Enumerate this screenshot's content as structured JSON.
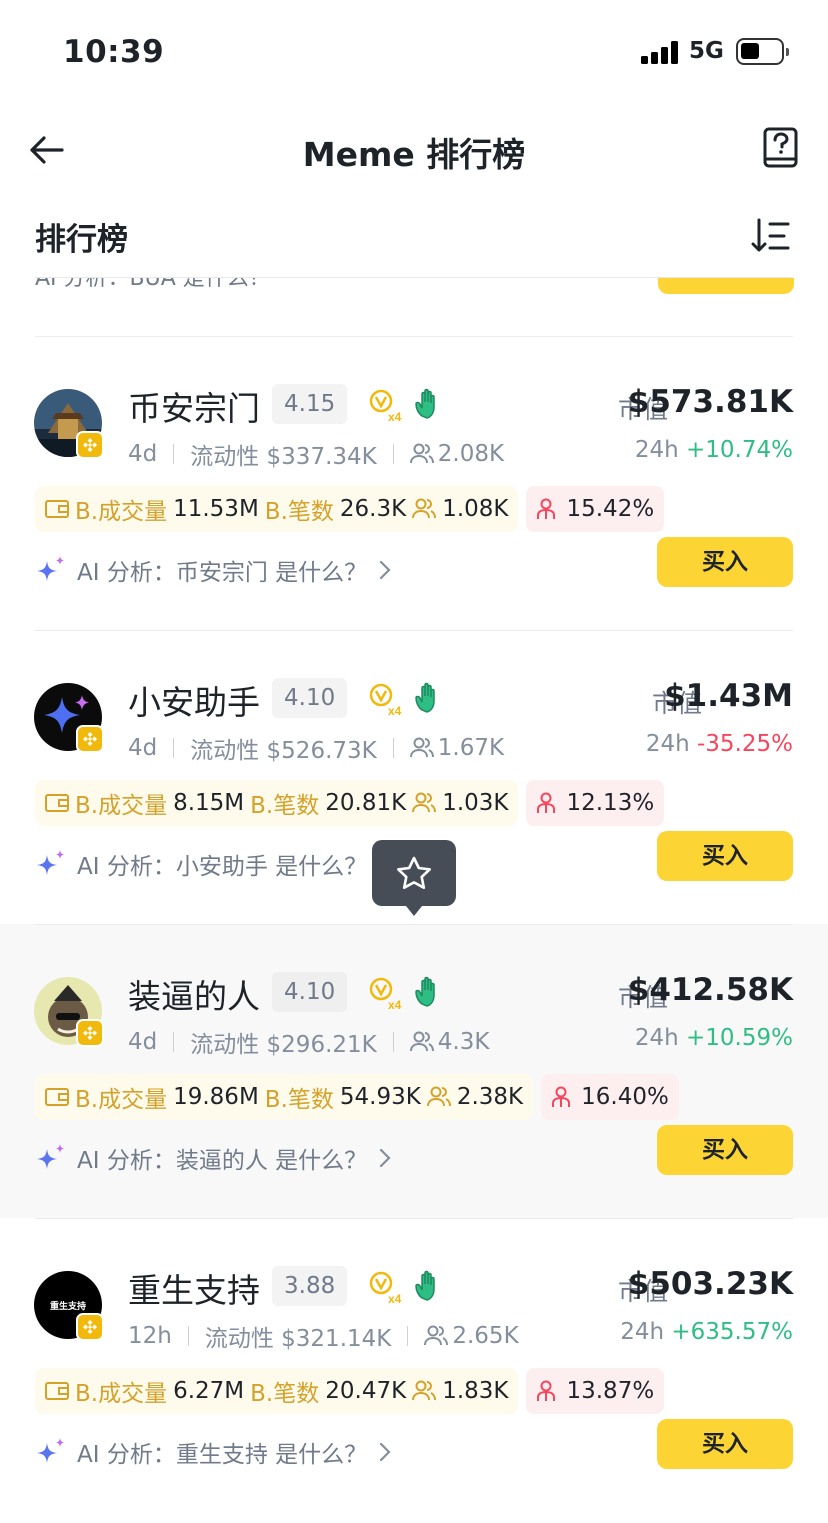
{
  "status_bar": {
    "time": "10:39",
    "network": "5G"
  },
  "nav": {
    "title": "Meme 排行榜"
  },
  "section": {
    "title": "排行榜"
  },
  "peek": {
    "ai_text": "AI 分析：BUA 是什么？"
  },
  "colors": {
    "accent": "#fcd535",
    "up": "#2ebd85",
    "down": "#f6465d",
    "tag_label": "#d4a22a"
  },
  "tokens": [
    {
      "name": "币安宗门",
      "score": "4.15",
      "age": "4d",
      "liquidity": "流动性 $337.34K",
      "holders": "2.08K",
      "mcap_label": "市值",
      "mcap": "$573.81K",
      "change_label": "24h",
      "change": "+10.74%",
      "direction": "up",
      "b_volume_label": "B.成交量",
      "b_volume": "11.53M",
      "b_trades_label": "B.笔数",
      "b_trades": "26.3K",
      "b_users": "1.08K",
      "top_holders": "15.42%",
      "ai_text": "AI 分析：币安宗门 是什么？",
      "buy_label": "买入"
    },
    {
      "name": "小安助手",
      "score": "4.10",
      "age": "4d",
      "liquidity": "流动性 $526.73K",
      "holders": "1.67K",
      "mcap_label": "市值",
      "mcap": "$1.43M",
      "change_label": "24h",
      "change": "-35.25%",
      "direction": "down",
      "b_volume_label": "B.成交量",
      "b_volume": "8.15M",
      "b_trades_label": "B.笔数",
      "b_trades": "20.81K",
      "b_users": "1.03K",
      "top_holders": "12.13%",
      "ai_text": "AI 分析：小安助手 是什么？",
      "buy_label": "买入"
    },
    {
      "name": "装逼的人",
      "score": "4.10",
      "age": "4d",
      "liquidity": "流动性 $296.21K",
      "holders": "4.3K",
      "mcap_label": "市值",
      "mcap": "$412.58K",
      "change_label": "24h",
      "change": "+10.59%",
      "direction": "up",
      "b_volume_label": "B.成交量",
      "b_volume": "19.86M",
      "b_trades_label": "B.笔数",
      "b_trades": "54.93K",
      "b_users": "2.38K",
      "top_holders": "16.40%",
      "ai_text": "AI 分析：装逼的人 是什么？",
      "buy_label": "买入"
    },
    {
      "name": "重生支持",
      "score": "3.88",
      "age": "12h",
      "liquidity": "流动性 $321.14K",
      "holders": "2.65K",
      "mcap_label": "市值",
      "mcap": "$503.23K",
      "change_label": "24h",
      "change": "+635.57%",
      "direction": "up",
      "b_volume_label": "B.成交量",
      "b_volume": "6.27M",
      "b_trades_label": "B.笔数",
      "b_trades": "20.47K",
      "b_users": "1.83K",
      "top_holders": "13.87%",
      "ai_text": "AI 分析：重生支持 是什么？",
      "buy_label": "买入",
      "avatar_text": "重生支持"
    }
  ]
}
